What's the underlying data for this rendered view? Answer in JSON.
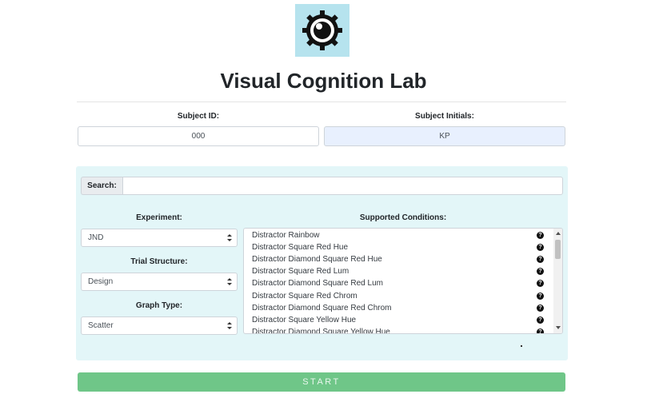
{
  "header": {
    "title": "Visual Cognition Lab",
    "logo_icon": "eye-gear-logo"
  },
  "subject": {
    "id_label": "Subject ID:",
    "id_value": "000",
    "initials_label": "Subject Initials:",
    "initials_value": "KP"
  },
  "search": {
    "label": "Search:",
    "value": ""
  },
  "experiment": {
    "label": "Experiment:",
    "selected": "JND"
  },
  "trial_structure": {
    "label": "Trial Structure:",
    "selected": "Design"
  },
  "graph_type": {
    "label": "Graph Type:",
    "selected": "Scatter"
  },
  "conditions": {
    "label": "Supported Conditions:",
    "items": [
      "Distractor Rainbow",
      "Distractor Square Red Hue",
      "Distractor Diamond Square Red Hue",
      "Distractor Square Red Lum",
      "Distractor Diamond Square Red Lum",
      "Distractor Square Red Chrom",
      "Distractor Diamond Square Red Chrom",
      "Distractor Square Yellow Hue",
      "Distractor Diamond Square Yellow Hue"
    ]
  },
  "start_button": {
    "label": "START"
  },
  "colors": {
    "panel": "#e3f6f8",
    "start": "#6fc688",
    "logo_bg": "#b6e3ee",
    "initials_bg": "#e8f0fe"
  }
}
